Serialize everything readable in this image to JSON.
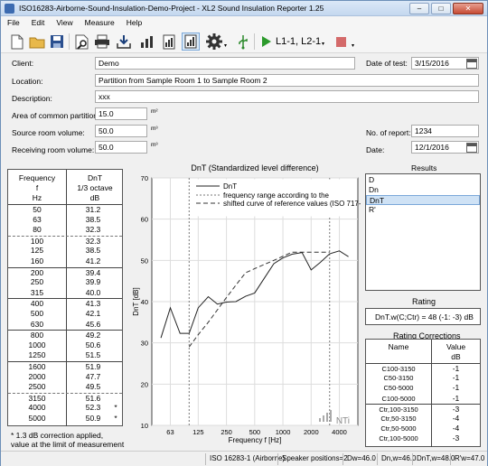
{
  "window": {
    "title": "ISO16283-Airborne-Sound-Insulation-Demo-Project  -  XL2 Sound Insulation Reporter 1.25"
  },
  "menu": [
    "File",
    "Edit",
    "View",
    "Measure",
    "Help"
  ],
  "toolbar": {
    "measurement": "L1-1, L2-1",
    "icons": [
      "new-icon",
      "open-icon",
      "save-icon",
      "preview-icon",
      "print-icon",
      "import-icon",
      "chart-bars-icon",
      "report-icon",
      "settings-icon",
      "usb-icon",
      "play-icon",
      "stop-icon"
    ]
  },
  "form": {
    "client_label": "Client:",
    "client": "Demo",
    "date_test_label": "Date of test:",
    "date_test": "3/15/2016",
    "location_label": "Location:",
    "location": "Partition from Sample Room 1 to Sample Room 2",
    "description_label": "Description:",
    "description": "xxx",
    "area_label": "Area of common partition:",
    "area": "15.0",
    "area_unit": "m²",
    "source_label": "Source room volume:",
    "source": "50.0",
    "source_unit": "m³",
    "receive_label": "Receiving room volume:",
    "receive": "50.0",
    "receive_unit": "m³",
    "report_no_label": "No. of report:",
    "report_no": "1234",
    "date_label": "Date:",
    "date": "12/1/2016"
  },
  "freq_table": {
    "head_freq": [
      "Frequency",
      "f",
      "Hz"
    ],
    "head_val": [
      "DnT",
      "1/3 octave",
      "dB"
    ],
    "rows": [
      [
        "50",
        "31.2",
        ""
      ],
      [
        "63",
        "38.5",
        ""
      ],
      [
        "80",
        "32.3",
        ""
      ],
      [
        "100",
        "32.3",
        ""
      ],
      [
        "125",
        "38.5",
        ""
      ],
      [
        "160",
        "41.2",
        ""
      ],
      [
        "200",
        "39.4",
        ""
      ],
      [
        "250",
        "39.9",
        ""
      ],
      [
        "315",
        "40.0",
        ""
      ],
      [
        "400",
        "41.3",
        ""
      ],
      [
        "500",
        "42.1",
        ""
      ],
      [
        "630",
        "45.6",
        ""
      ],
      [
        "800",
        "49.2",
        ""
      ],
      [
        "1000",
        "50.6",
        ""
      ],
      [
        "1250",
        "51.5",
        ""
      ],
      [
        "1600",
        "51.9",
        ""
      ],
      [
        "2000",
        "47.7",
        ""
      ],
      [
        "2500",
        "49.5",
        ""
      ],
      [
        "3150",
        "51.6",
        ""
      ],
      [
        "4000",
        "52.3",
        "*"
      ],
      [
        "5000",
        "50.9",
        "*"
      ]
    ],
    "footnote1": "* 1.3 dB correction applied,",
    "footnote2": "value at the limit of measurement"
  },
  "chart_data": {
    "type": "line",
    "title": "DnT (Standardized level difference)",
    "xlabel": "Frequency f [Hz]",
    "ylabel": "DnT [dB]",
    "x": [
      50,
      63,
      80,
      100,
      125,
      160,
      200,
      250,
      315,
      400,
      500,
      630,
      800,
      1000,
      1250,
      1600,
      2000,
      2500,
      3150,
      4000,
      5000
    ],
    "series": [
      {
        "name": "DnT",
        "values": [
          31.2,
          38.5,
          32.3,
          32.3,
          38.5,
          41.2,
          39.4,
          39.9,
          40.0,
          41.3,
          42.1,
          45.6,
          49.2,
          50.6,
          51.5,
          51.9,
          47.7,
          49.5,
          51.6,
          52.3,
          50.9
        ]
      },
      {
        "name": "shifted curve of reference values (ISO 717-1)",
        "x": [
          100,
          125,
          160,
          200,
          250,
          315,
          400,
          500,
          630,
          800,
          1000,
          1250,
          1600,
          2000,
          2500,
          3150
        ],
        "values": [
          29,
          32,
          35,
          38,
          41,
          44,
          47,
          48,
          49,
          50,
          51,
          52,
          52,
          52,
          52,
          52
        ]
      }
    ],
    "legend": [
      "DnT",
      "frequency range according to the",
      "shifted curve of reference values (ISO 717-1)"
    ],
    "xticks": [
      "63",
      "125",
      "250",
      "500",
      "1000",
      "2000",
      "4000"
    ],
    "yticks": [
      "10",
      "20",
      "30",
      "40",
      "50",
      "60",
      "70"
    ],
    "ylim": [
      10,
      70
    ],
    "range_lines_hz": [
      100,
      3150
    ],
    "watermark": "NTi"
  },
  "results": {
    "title": "Results",
    "items": [
      "D",
      "Dn",
      "DnT",
      "R'"
    ],
    "selected": 2
  },
  "rating": {
    "title": "Rating",
    "value": "DnT.w(C;Ctr) = 48 (-1: -3) dB"
  },
  "corrections": {
    "title": "Rating Corrections",
    "head_name": "Name",
    "head_val": [
      "Value",
      "dB"
    ],
    "rows": [
      [
        "C100-3150",
        "-1"
      ],
      [
        "C50-3150",
        "-1"
      ],
      [
        "C50-5000",
        "-1"
      ],
      [
        "C100-5000",
        "-1"
      ],
      [
        "Ctr,100-3150",
        "-3"
      ],
      [
        "Ctr,50-3150",
        "-4"
      ],
      [
        "Ctr,50-5000",
        "-4"
      ],
      [
        "Ctr,100-5000",
        "-3"
      ]
    ]
  },
  "status": {
    "standard": "ISO 16283-1 (Airborne)",
    "speakers": "Speaker positions=2",
    "dw": "Dw=46.0",
    "dnw": "Dn,w=46.0",
    "dntw": "DnT,w=48.0",
    "rw": "R'w=47.0"
  }
}
